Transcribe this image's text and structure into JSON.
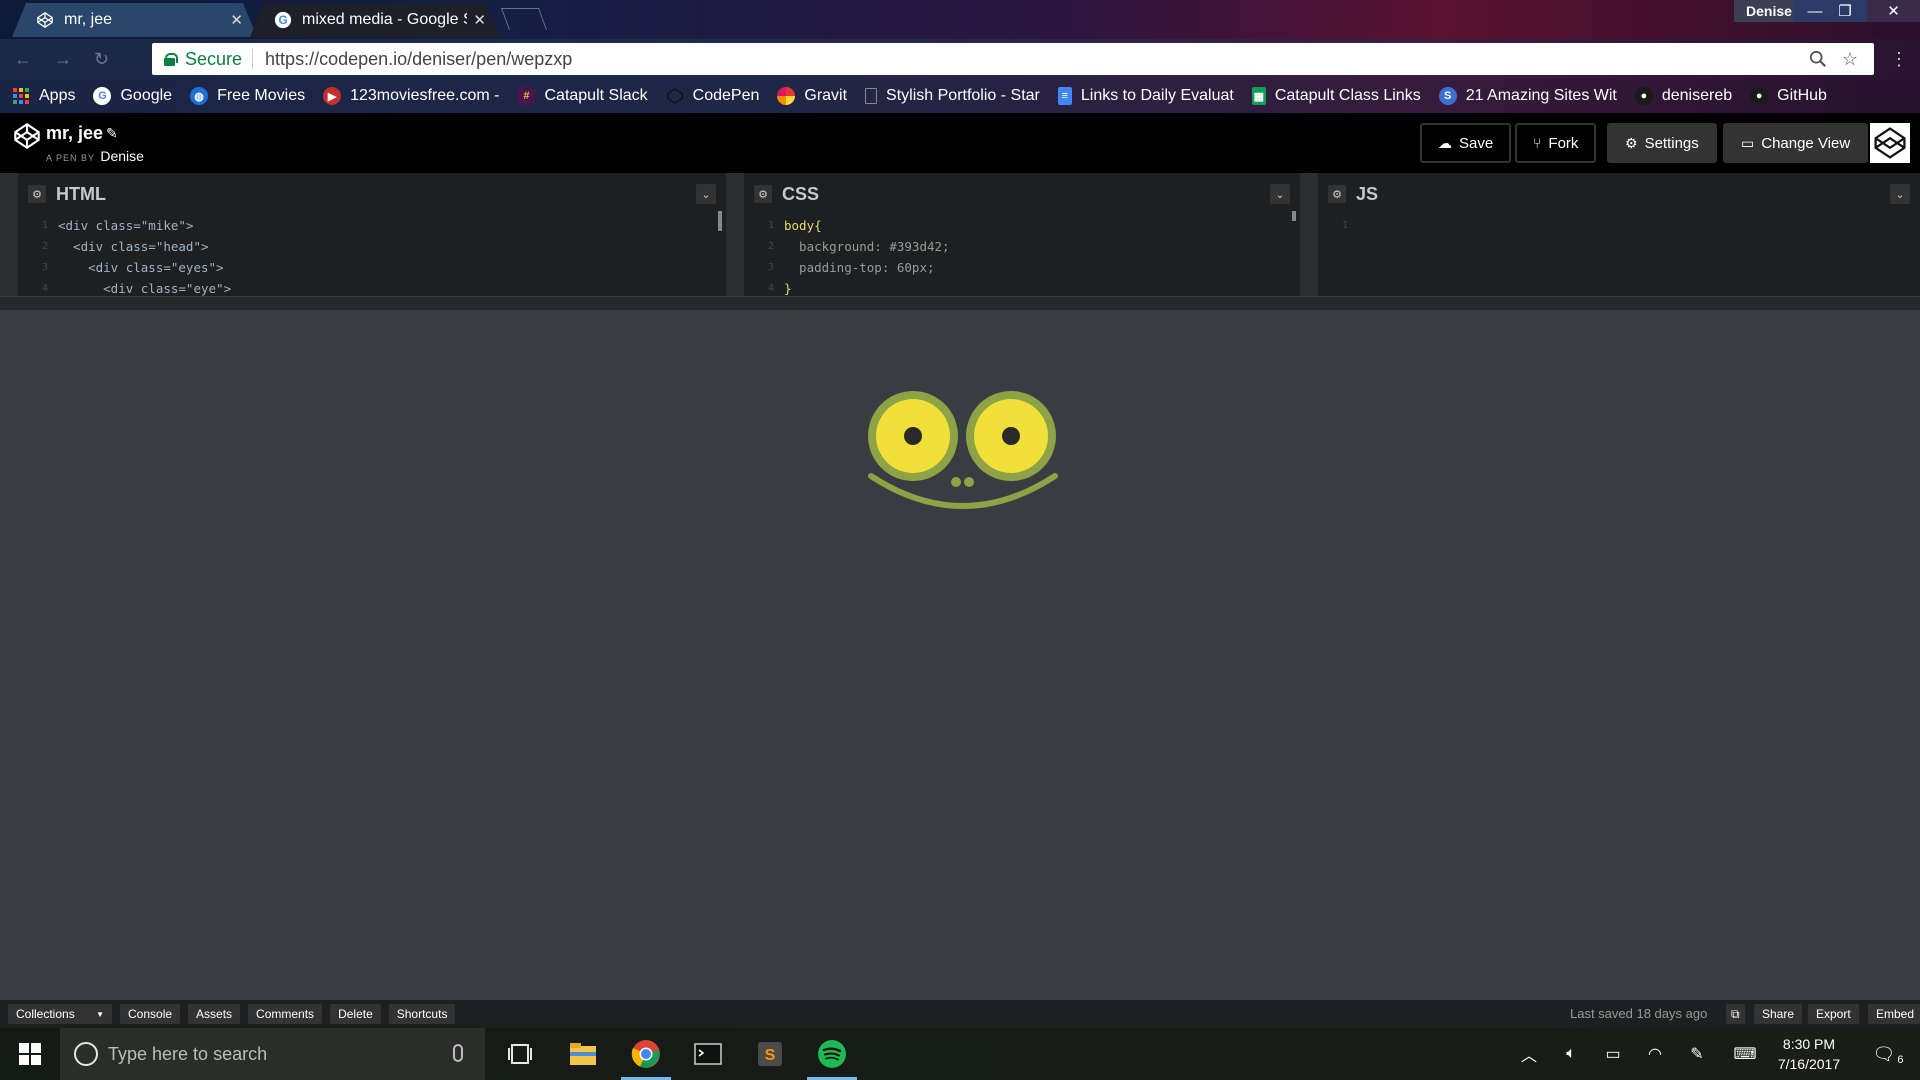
{
  "browser": {
    "tabs": [
      {
        "title": "mr, jee",
        "favicon": "codepen-icon",
        "active": true
      },
      {
        "title": "mixed media - Google S",
        "favicon": "google-icon",
        "active": false
      }
    ],
    "profile_name": "Denise",
    "address": {
      "secure_label": "Secure",
      "url": "https://codepen.io/deniser/pen/wepzxp"
    },
    "bookmarks": [
      {
        "label": "Apps",
        "icon": "apps-grid-icon"
      },
      {
        "label": "Google",
        "icon": "google-icon"
      },
      {
        "label": "Free Movies",
        "icon": "globe-icon"
      },
      {
        "label": "123moviesfree.com -",
        "icon": "youtube-icon"
      },
      {
        "label": "Catapult Slack",
        "icon": "slack-icon"
      },
      {
        "label": "CodePen",
        "icon": "codepen-icon"
      },
      {
        "label": "Gravit",
        "icon": "gravit-icon"
      },
      {
        "label": "Stylish Portfolio - Star",
        "icon": "page-icon"
      },
      {
        "label": "Links to Daily Evaluat",
        "icon": "docs-icon"
      },
      {
        "label": "Catapult Class Links",
        "icon": "sheets-icon"
      },
      {
        "label": "21 Amazing Sites Wit",
        "icon": "site-icon"
      },
      {
        "label": "denisereb",
        "icon": "github-icon"
      },
      {
        "label": "GitHub",
        "icon": "github-icon"
      }
    ]
  },
  "codepen": {
    "pen_title": "mr, jee",
    "pen_by_label": "A PEN BY",
    "author": "Denise",
    "buttons": {
      "save": "Save",
      "fork": "Fork",
      "settings": "Settings",
      "change_view": "Change View"
    },
    "editors": {
      "html": {
        "name": "HTML",
        "lines": [
          {
            "n": "1",
            "text": "<div class=\"mike\">"
          },
          {
            "n": "2",
            "text": "  <div class=\"head\">"
          },
          {
            "n": "3",
            "text": "    <div class=\"eyes\">"
          },
          {
            "n": "4",
            "text": "      <div class=\"eye\">"
          }
        ]
      },
      "css": {
        "name": "CSS",
        "lines": [
          {
            "n": "1",
            "text": "body{"
          },
          {
            "n": "2",
            "text": "  background: #393d42;"
          },
          {
            "n": "3",
            "text": "  padding-top: 60px;"
          },
          {
            "n": "4",
            "text": "}"
          }
        ]
      },
      "js": {
        "name": "JS",
        "lines": [
          {
            "n": "1",
            "text": ""
          }
        ]
      }
    },
    "footer": {
      "collections": "Collections",
      "console": "Console",
      "assets": "Assets",
      "comments": "Comments",
      "delete": "Delete",
      "shortcuts": "Shortcuts",
      "last_saved": "Last saved 18 days ago",
      "share": "Share",
      "export": "Export",
      "embed": "Embed"
    },
    "preview": {
      "background": "#393d42",
      "face_green": "#8ea246",
      "eye_yellow": "#f2e03a",
      "pupil": "#2a2a2a"
    }
  },
  "taskbar": {
    "search_placeholder": "Type here to search",
    "time": "8:30 PM",
    "date": "7/16/2017",
    "notification_count": "6"
  }
}
